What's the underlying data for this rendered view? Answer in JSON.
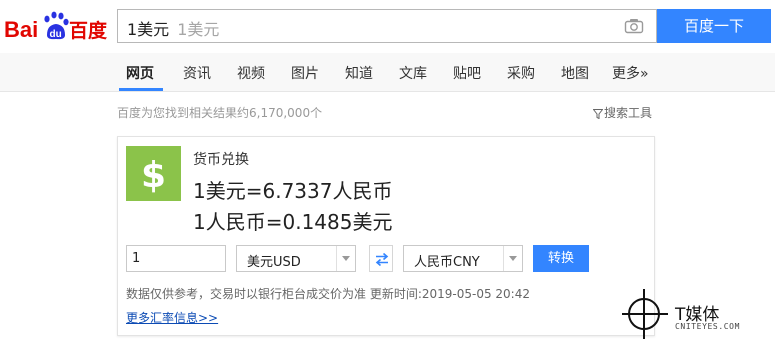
{
  "logo": {
    "brand_text": "Bai百度",
    "color_red": "#e10601",
    "color_blue": "#2932e1"
  },
  "search": {
    "query": "1美元",
    "hint": "1美元",
    "button_label": "百度一下"
  },
  "nav": {
    "tabs": [
      {
        "label": "网页",
        "active": true
      },
      {
        "label": "资讯"
      },
      {
        "label": "视频"
      },
      {
        "label": "图片"
      },
      {
        "label": "知道"
      },
      {
        "label": "文库"
      },
      {
        "label": "贴吧"
      },
      {
        "label": "采购"
      },
      {
        "label": "地图"
      },
      {
        "label": "更多»"
      }
    ]
  },
  "results": {
    "count_text": "百度为您找到相关结果约6,170,000个",
    "tools_label": "搜索工具"
  },
  "converter": {
    "title": "货币兑换",
    "rate_usd_to_cny": "1美元=6.7337人民币",
    "rate_cny_to_usd": "1人民币=0.1485美元",
    "amount": "1",
    "from_currency": "美元USD",
    "to_currency": "人民币CNY",
    "convert_label": "转换",
    "disclaimer": "数据仅供参考，交易时以银行柜台成交价为准 更新时间:2019-05-05 20:42",
    "more_link": "更多汇率信息>>",
    "icon": "dollar-icon",
    "accent": "#3385ff",
    "icon_color": "#8bc34a"
  },
  "watermark": {
    "text": "T媒体",
    "sub": "CNITEYES.COM"
  }
}
